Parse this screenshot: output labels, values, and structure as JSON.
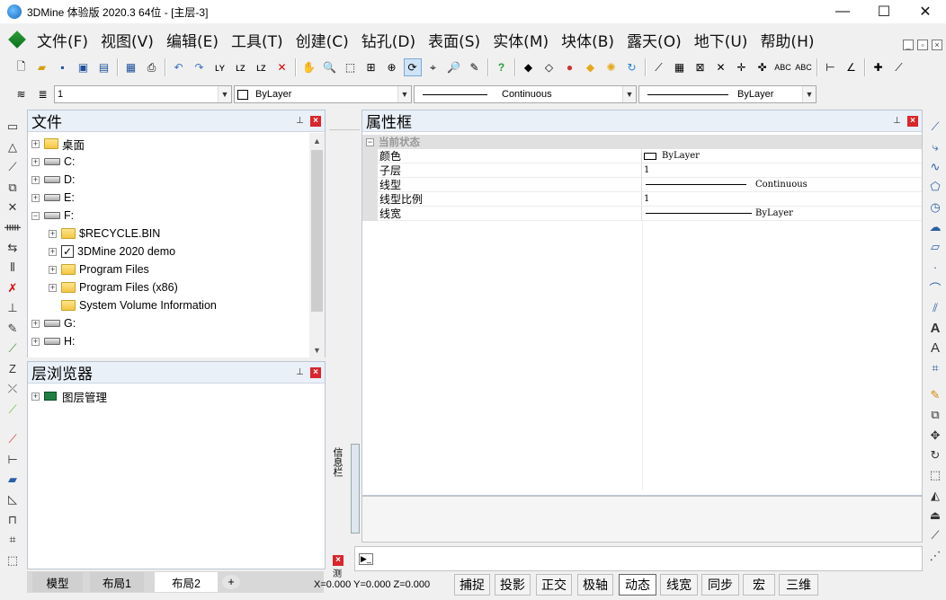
{
  "window": {
    "title": "3DMine 体验版 2020.3 64位 - [主层-3]",
    "minimize": "—",
    "maximize": "☐",
    "close": "✕"
  },
  "menu": [
    "文件(F)",
    "视图(V)",
    "编辑(E)",
    "工具(T)",
    "创建(C)",
    "钻孔(D)",
    "表面(S)",
    "实体(M)",
    "块体(B)",
    "露天(O)",
    "地下(U)",
    "帮助(H)"
  ],
  "props": {
    "layer": "1",
    "color": "ByLayer",
    "linetype": "Continuous",
    "lineweight": "ByLayer"
  },
  "file_panel": {
    "title": "文件",
    "items": [
      {
        "label": "桌面",
        "type": "folder",
        "level": 0
      },
      {
        "label": "C:",
        "type": "drive",
        "level": 0
      },
      {
        "label": "D:",
        "type": "drive",
        "level": 0
      },
      {
        "label": "E:",
        "type": "drive",
        "level": 0
      },
      {
        "label": "F:",
        "type": "drive",
        "level": 0,
        "expanded": true
      },
      {
        "label": "$RECYCLE.BIN",
        "type": "folder",
        "level": 1
      },
      {
        "label": "3DMine 2020 demo",
        "type": "check",
        "level": 1
      },
      {
        "label": "Program Files",
        "type": "folder",
        "level": 1
      },
      {
        "label": "Program Files (x86)",
        "type": "folder",
        "level": 1
      },
      {
        "label": "System Volume Information",
        "type": "folder",
        "level": 1,
        "noexpander": true
      },
      {
        "label": "G:",
        "type": "drive",
        "level": 0
      },
      {
        "label": "H:",
        "type": "drive",
        "level": 0
      }
    ]
  },
  "layer_panel": {
    "title": "层浏览器",
    "items": [
      {
        "label": "图层管理"
      }
    ]
  },
  "attr_panel": {
    "title": "属性框",
    "section": "当前状态",
    "rows": [
      {
        "name": "颜色",
        "value": "ByLayer"
      },
      {
        "name": "子层",
        "value": "1"
      },
      {
        "name": "线型",
        "value": "Continuous"
      },
      {
        "name": "线型比例",
        "value": "1"
      },
      {
        "name": "线宽",
        "value": "ByLayer"
      }
    ]
  },
  "side_tab": "信息栏",
  "side_tab2": "测",
  "layout_tabs": [
    "模型",
    "布局1",
    "布局2"
  ],
  "add_tab": "+",
  "coords": "X=0.000 Y=0.000 Z=0.000",
  "status_buttons": [
    "捕捉",
    "投影",
    "正交",
    "极轴",
    "动态",
    "线宽",
    "同步",
    "宏",
    "三维"
  ],
  "status_active": "动态",
  "command_prompt": "▶_"
}
